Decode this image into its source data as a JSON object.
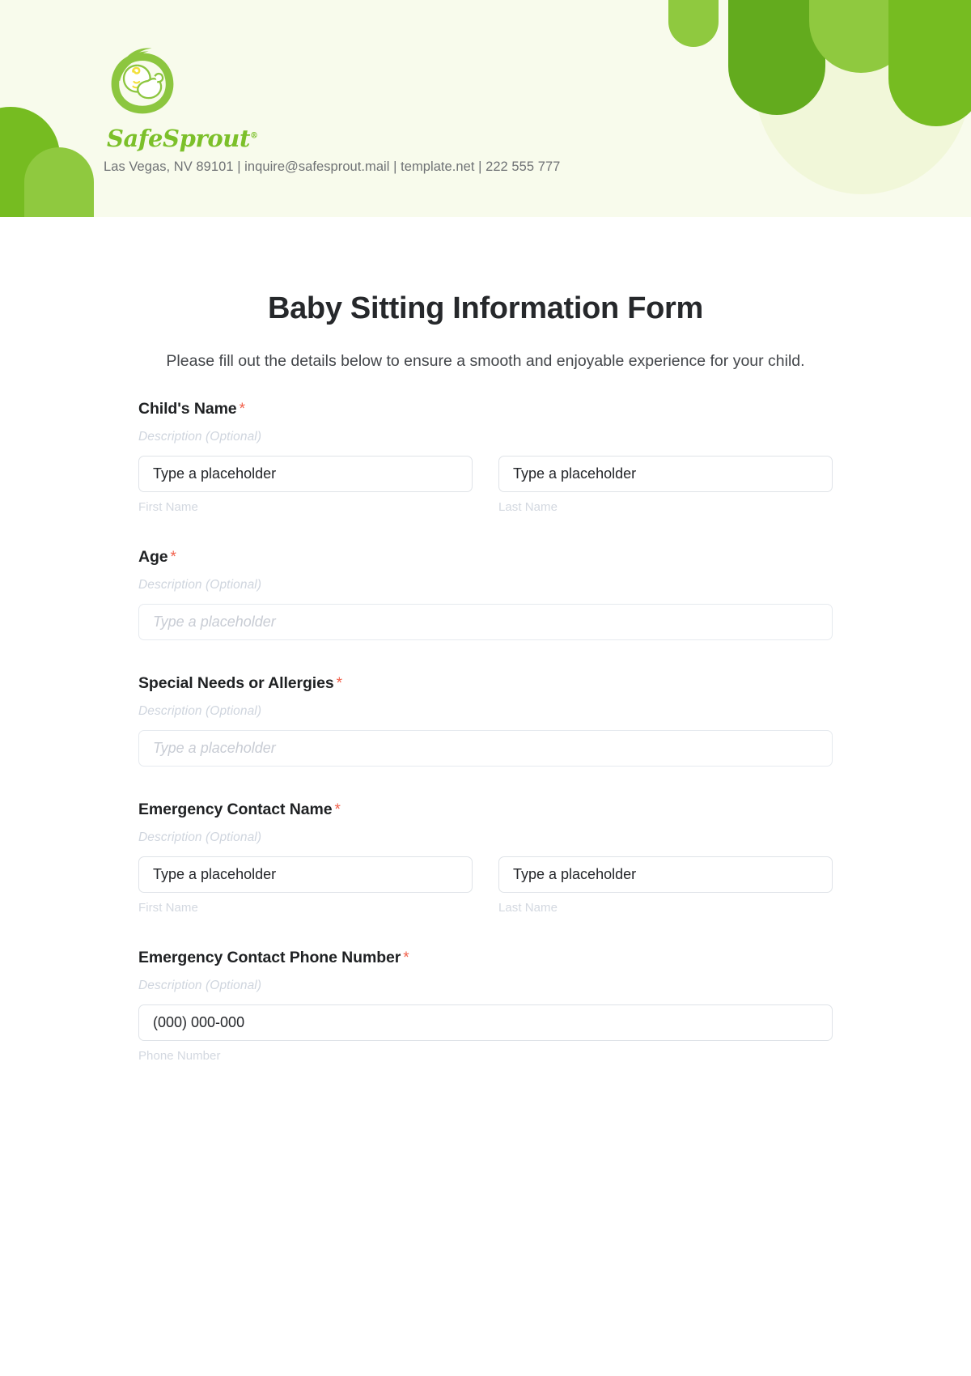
{
  "header": {
    "brand_name": "SafeSprout",
    "trademark": "®",
    "contact": "Las Vegas, NV 89101 | inquire@safesprout.mail | template.net | 222 555 777",
    "logo_icon": "baby-sprout-logo-icon",
    "colors": {
      "background": "#f8fbec",
      "brand_green": "#7cc02a",
      "blob_green_dark": "#63ab1e",
      "blob_green_mid": "#76bc21",
      "blob_green_light": "#8fc93f",
      "blob_pale": "#f1f7d9",
      "logo_accent_yellow": "#f2e03a"
    }
  },
  "form": {
    "title": "Baby Sitting Information Form",
    "subtitle": "Please fill out the details below to ensure a smooth and enjoyable experience for your child.",
    "required_marker": "*",
    "required_color": "#f1604b",
    "fields": [
      {
        "label": "Child's Name",
        "required": true,
        "description": "Description (Optional)",
        "type": "name-pair",
        "inputs": [
          {
            "value": "Type a placeholder",
            "sub_label": "First Name",
            "style": "filled"
          },
          {
            "value": "Type a placeholder",
            "sub_label": "Last Name",
            "style": "filled"
          }
        ]
      },
      {
        "label": "Age",
        "required": true,
        "description": "Description (Optional)",
        "type": "single",
        "inputs": [
          {
            "value": "Type a placeholder",
            "sub_label": "",
            "style": "ghost"
          }
        ]
      },
      {
        "label": "Special Needs or Allergies",
        "required": true,
        "description": "Description (Optional)",
        "type": "single",
        "inputs": [
          {
            "value": "Type a placeholder",
            "sub_label": "",
            "style": "ghost"
          }
        ]
      },
      {
        "label": "Emergency Contact Name",
        "required": true,
        "description": "Description (Optional)",
        "type": "name-pair",
        "inputs": [
          {
            "value": "Type a placeholder",
            "sub_label": "First Name",
            "style": "filled"
          },
          {
            "value": "Type a placeholder",
            "sub_label": "Last Name",
            "style": "filled"
          }
        ]
      },
      {
        "label": "Emergency Contact Phone Number",
        "required": true,
        "description": "Description (Optional)",
        "type": "single",
        "inputs": [
          {
            "value": "(000) 000-000",
            "sub_label": "Phone Number",
            "style": "filled"
          }
        ]
      }
    ]
  }
}
